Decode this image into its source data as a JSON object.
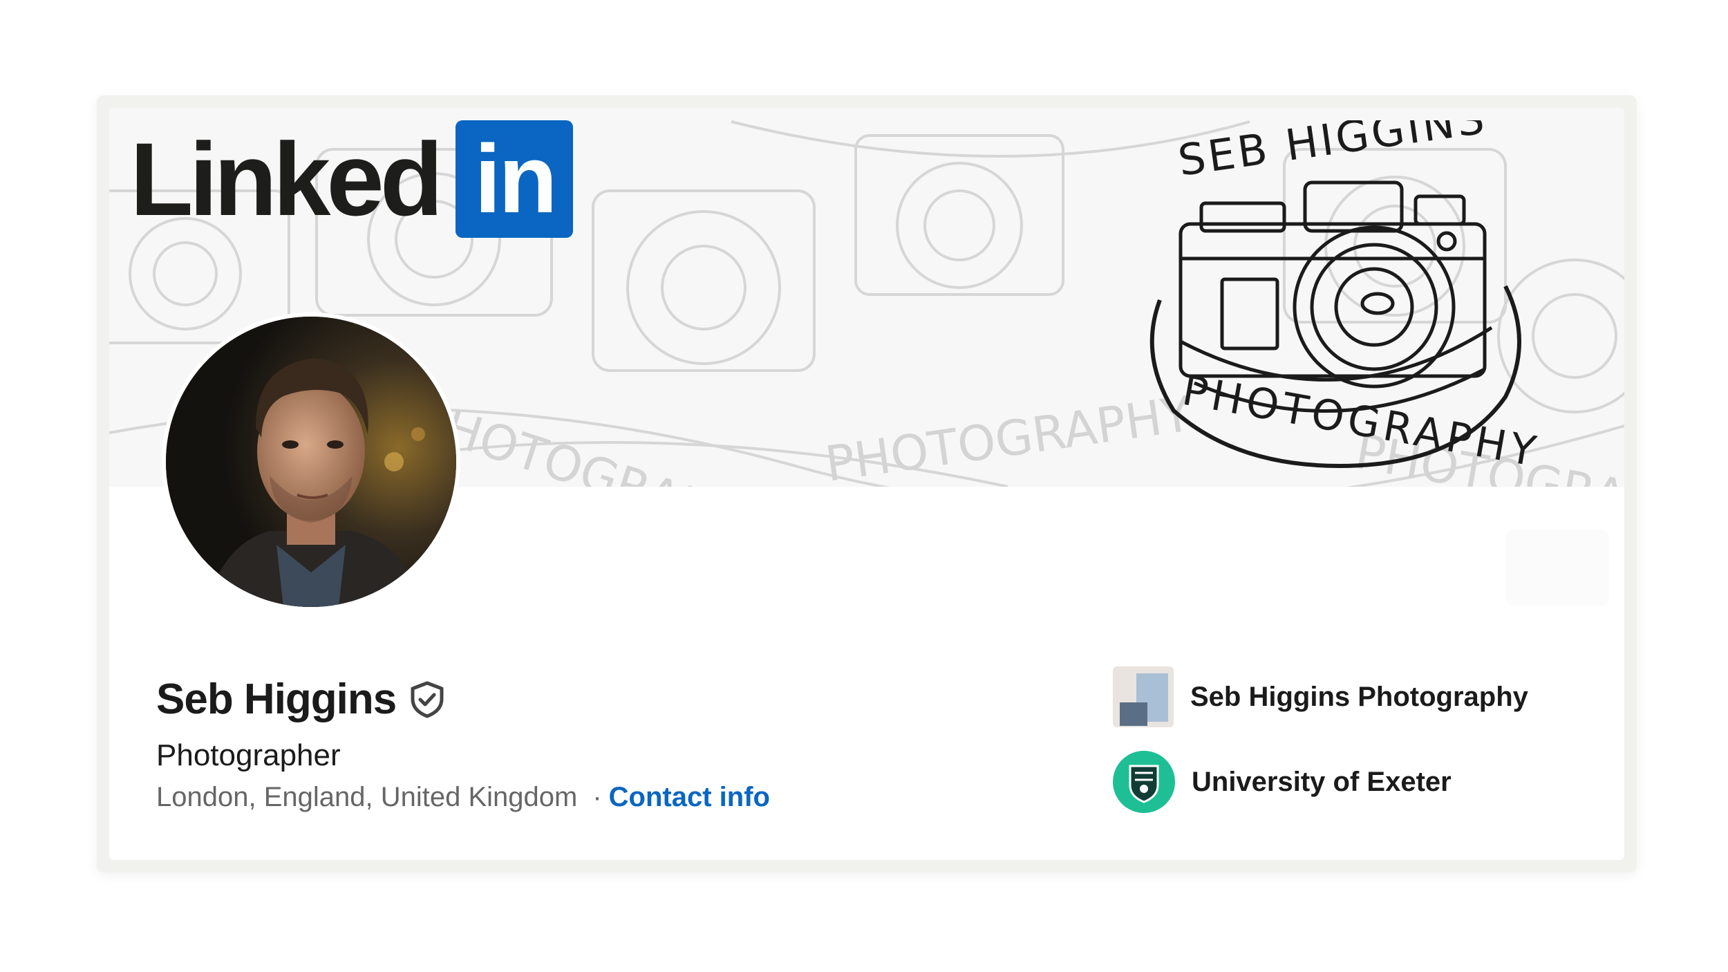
{
  "banner": {
    "linkedin_word": "Linked",
    "linkedin_box": "in",
    "brand_logo_text_top": "SEB HIGGINS",
    "brand_logo_text_bottom": "PHOTOGRAPHY",
    "pattern_text": "PHOTOGRAPHY"
  },
  "profile": {
    "name": "Seb Higgins",
    "headline": "Photographer",
    "location": "London, England, United Kingdom",
    "separator": "·",
    "contact_label": "Contact info"
  },
  "affiliations": [
    {
      "label": "Seb Higgins Photography",
      "icon": "company-logo"
    },
    {
      "label": "University of Exeter",
      "icon": "university-crest"
    }
  ],
  "colors": {
    "linkedin_blue": "#0a66c2",
    "university_green": "#1fbf95"
  }
}
